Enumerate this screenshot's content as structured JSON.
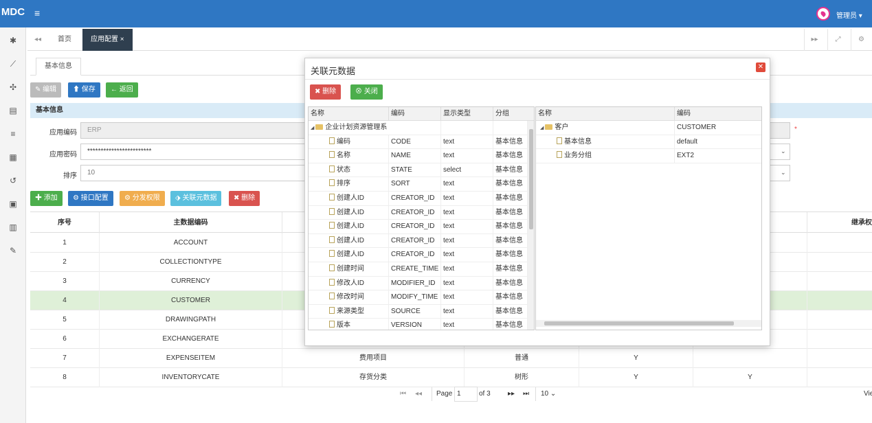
{
  "app": {
    "logo": "MDC",
    "menu_icon": "menu-icon",
    "user": "管理员 ▾"
  },
  "sidebar": {
    "icons": [
      "dashboard-icon",
      "chart-icon",
      "spinner-icon",
      "database-icon",
      "list-icon",
      "table-icon",
      "history-icon",
      "film-icon",
      "calendar-icon",
      "wrench-icon"
    ]
  },
  "tabs": {
    "home": "首页",
    "config": "应用配置 ×"
  },
  "inner_tab": "基本信息",
  "toolbar": {
    "edit": "编辑",
    "save": "保存",
    "back": "返回"
  },
  "section": "基本信息",
  "form": {
    "code_label": "应用编码",
    "code_value": "ERP",
    "pwd_label": "应用密码",
    "pwd_value": "************************",
    "order_label": "排序",
    "order_value": "10",
    "required_mark": "*"
  },
  "actions": {
    "add": "添加",
    "api": "接口配置",
    "perm": "分发权限",
    "link": "关联元数据",
    "delete": "删除"
  },
  "grid": {
    "headers": [
      "序号",
      "主数据编码",
      "继承权"
    ],
    "rows": [
      {
        "no": "1",
        "code": "ACCOUNT",
        "name": "",
        "type": "",
        "c5": "",
        "c6": ""
      },
      {
        "no": "2",
        "code": "COLLECTIONTYPE",
        "name": "",
        "type": "",
        "c5": "",
        "c6": ""
      },
      {
        "no": "3",
        "code": "CURRENCY",
        "name": "",
        "type": "",
        "c5": "",
        "c6": ""
      },
      {
        "no": "4",
        "code": "CUSTOMER",
        "name": "",
        "type": "",
        "c5": "",
        "c6": ""
      },
      {
        "no": "5",
        "code": "DRAWINGPATH",
        "name": "",
        "type": "",
        "c5": "",
        "c6": ""
      },
      {
        "no": "6",
        "code": "EXCHANGERATE",
        "name": "",
        "type": "",
        "c5": "",
        "c6": ""
      },
      {
        "no": "7",
        "code": "EXPENSEITEM",
        "name": "费用项目",
        "type": "普通",
        "c5": "Y",
        "c6": ""
      },
      {
        "no": "8",
        "code": "INVENTORYCATE",
        "name": "存货分类",
        "type": "树形",
        "c5": "Y",
        "c6": "Y"
      }
    ]
  },
  "pager": {
    "page_label": "Page",
    "page_value": "1",
    "of": "of 3",
    "size": "10",
    "view": "Vie"
  },
  "modal": {
    "title": "关联元数据",
    "delete": "删除",
    "close": "关闭",
    "left_headers": [
      "名称",
      "编码",
      "显示类型",
      "分组"
    ],
    "left_root": "企业计划资源管理系",
    "left_rows": [
      {
        "name": "编码",
        "code": "CODE",
        "type": "text",
        "group": "基本信息"
      },
      {
        "name": "名称",
        "code": "NAME",
        "type": "text",
        "group": "基本信息"
      },
      {
        "name": "状态",
        "code": "STATE",
        "type": "select",
        "group": "基本信息"
      },
      {
        "name": "排序",
        "code": "SORT",
        "type": "text",
        "group": "基本信息"
      },
      {
        "name": "创建人ID",
        "code": "CREATOR_ID",
        "type": "text",
        "group": "基本信息"
      },
      {
        "name": "创建人ID",
        "code": "CREATOR_ID",
        "type": "text",
        "group": "基本信息"
      },
      {
        "name": "创建人ID",
        "code": "CREATOR_ID",
        "type": "text",
        "group": "基本信息"
      },
      {
        "name": "创建人ID",
        "code": "CREATOR_ID",
        "type": "text",
        "group": "基本信息"
      },
      {
        "name": "创建人ID",
        "code": "CREATOR_ID",
        "type": "text",
        "group": "基本信息"
      },
      {
        "name": "创建时间",
        "code": "CREATE_TIME",
        "type": "text",
        "group": "基本信息"
      },
      {
        "name": "修改人ID",
        "code": "MODIFIER_ID",
        "type": "text",
        "group": "基本信息"
      },
      {
        "name": "修改时间",
        "code": "MODIFY_TIME",
        "type": "text",
        "group": "基本信息"
      },
      {
        "name": "来源类型",
        "code": "SOURCE",
        "type": "text",
        "group": "基本信息"
      },
      {
        "name": "版本",
        "code": "VERSION",
        "type": "text",
        "group": "基本信息"
      }
    ],
    "right_headers": [
      "名称",
      "编码"
    ],
    "right_rows": [
      {
        "name": "客户",
        "code": "CUSTOMER"
      },
      {
        "name": "基本信息",
        "code": "default"
      },
      {
        "name": "业务分组",
        "code": "EXT2"
      }
    ]
  }
}
